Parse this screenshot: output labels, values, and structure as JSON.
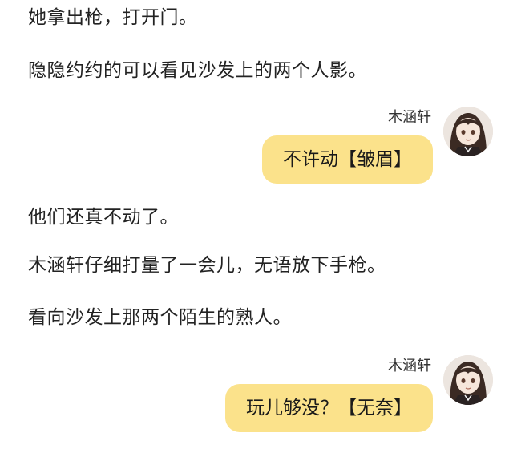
{
  "theme": {
    "bubble_color": "#fbe28b",
    "text_color": "#222222"
  },
  "lines": [
    "她拿出枪，打开门。",
    "隐隐约约的可以看见沙发上的两个人影。",
    "他们还真不动了。",
    "木涵轩仔细打量了一会儿，无语放下手枪。",
    "看向沙发上那两个陌生的熟人。"
  ],
  "messages": [
    {
      "speaker": "木涵轩",
      "text": "不许动【皱眉】",
      "avatar_icon": "anime-girl-avatar"
    },
    {
      "speaker": "木涵轩",
      "text": "玩儿够没？【无奈】",
      "avatar_icon": "anime-girl-avatar"
    }
  ]
}
